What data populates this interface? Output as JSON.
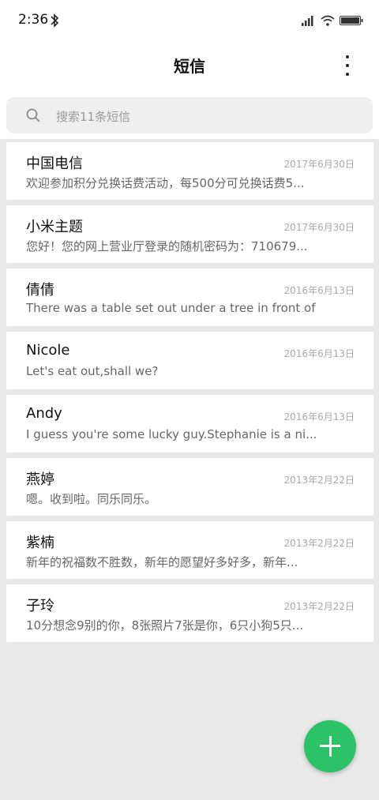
{
  "status_bar": {
    "time": "2:36",
    "icons": [
      "bluetooth-icon",
      "signal-icon",
      "wifi-icon",
      "battery-icon"
    ]
  },
  "header": {
    "title": "短信",
    "menu_icon": "more-vertical-icon"
  },
  "search": {
    "placeholder": "搜索11条短信",
    "icon": "search-icon"
  },
  "conversations": [
    {
      "name": "中国电信",
      "date": "2017年6月30日",
      "preview": "欢迎参加积分兑换话费活动，每500分可兑换话费5..."
    },
    {
      "name": "小米主题",
      "date": "2017年6月30日",
      "preview": "您好！您的网上营业厅登录的随机密码为：710679..."
    },
    {
      "name": "倩倩",
      "date": "2016年6月13日",
      "preview": "There was a table set out under a tree in front of ..."
    },
    {
      "name": "Nicole",
      "date": "2016年6月13日",
      "preview": "Let's eat out,shall we?"
    },
    {
      "name": "Andy",
      "date": "2016年6月13日",
      "preview": "I guess you're some lucky guy.Stephanie is a ni..."
    },
    {
      "name": "燕婷",
      "date": "2013年2月22日",
      "preview": "嗯。收到啦。同乐同乐。"
    },
    {
      "name": "紫楠",
      "date": "2013年2月22日",
      "preview": "新年的祝福数不胜数，新年的愿望好多好多，新年..."
    },
    {
      "name": "子玲",
      "date": "2013年2月22日",
      "preview": "10分想念9别的你，8张照片7张是你，6只小狗5只..."
    }
  ],
  "fab": {
    "icon": "plus-icon",
    "color": "#2bc268"
  }
}
